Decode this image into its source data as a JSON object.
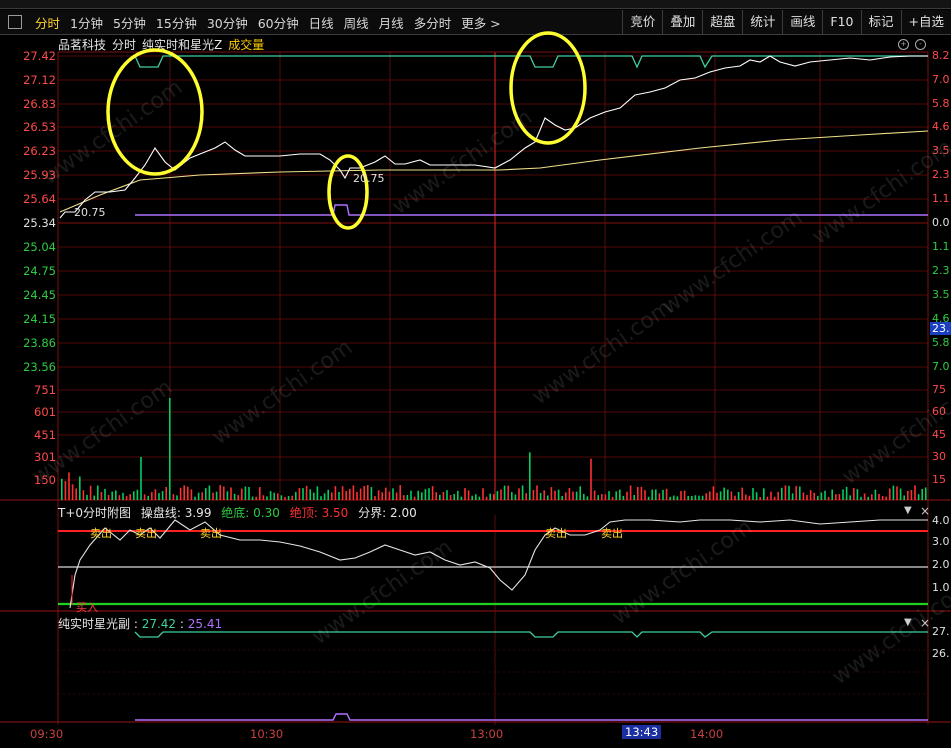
{
  "toolbar": {
    "tabs": [
      {
        "label": "分时",
        "active": true
      },
      {
        "label": "1分钟"
      },
      {
        "label": "5分钟"
      },
      {
        "label": "15分钟"
      },
      {
        "label": "30分钟"
      },
      {
        "label": "60分钟"
      },
      {
        "label": "日线"
      },
      {
        "label": "周线"
      },
      {
        "label": "月线"
      },
      {
        "label": "多分时"
      },
      {
        "label": "更多 >"
      }
    ],
    "right_buttons": [
      "竞价",
      "叠加",
      "超盘",
      "统计",
      "画线",
      "F10",
      "标记",
      "+自选"
    ]
  },
  "main_header": {
    "stock_name": "品茗科技",
    "mode": "分时",
    "indicator": "纯实时和星光Z",
    "volume_label": "成交量"
  },
  "price_axis_left": [
    "27.42",
    "27.12",
    "26.83",
    "26.53",
    "26.23",
    "25.93",
    "25.64",
    "25.34",
    "25.04",
    "24.75",
    "24.45",
    "24.15",
    "23.86",
    "23.56"
  ],
  "price_axis_right": [
    "8.2",
    "7.0",
    "5.8",
    "4.6",
    "3.5",
    "2.3",
    "1.1",
    "0.0",
    "1.1",
    "2.3",
    "3.5",
    "4.6",
    "5.8",
    "7.0"
  ],
  "current_price_tag": "23.",
  "price_annotations": [
    "20.75",
    "20.75"
  ],
  "volume_axis_left": [
    "751",
    "601",
    "451",
    "301",
    "150"
  ],
  "volume_axis_right": [
    "75",
    "60",
    "45",
    "30",
    "15"
  ],
  "sub1": {
    "title": "T+0分时附图",
    "fields": [
      {
        "label": "操盘线:",
        "value": "3.99",
        "color": "#e0e0e0"
      },
      {
        "label": "绝底:",
        "value": "0.30",
        "color": "#2ecc40"
      },
      {
        "label": "绝顶:",
        "value": "3.50",
        "color": "#ff3030"
      },
      {
        "label": "分界:",
        "value": "2.00",
        "color": "#e0e0e0"
      }
    ],
    "axis_right": [
      "4.0",
      "3.0",
      "2.0",
      "1.0"
    ],
    "signals_sell": [
      "卖出",
      "卖出",
      "卖出",
      "卖出",
      "卖出"
    ],
    "signal_buy": "买入"
  },
  "sub2": {
    "title": "纯实时星光副",
    "value1": "27.42",
    "value2": "25.41",
    "axis_right": [
      "27.",
      "26."
    ]
  },
  "time_axis": {
    "labels": [
      "09:30",
      "10:30",
      "13:00",
      "14:00"
    ],
    "current": "13:43"
  },
  "watermark": "www.cfchi.com",
  "colors": {
    "up": "#ff3030",
    "down": "#00d060",
    "grid": "#6a0e0e",
    "price_line": "#ffffff",
    "avg_line": "#f0e08a",
    "cyan_line": "#3fd0a0",
    "purple_line": "#b070ff",
    "highlight_circle": "#ffff30"
  }
}
